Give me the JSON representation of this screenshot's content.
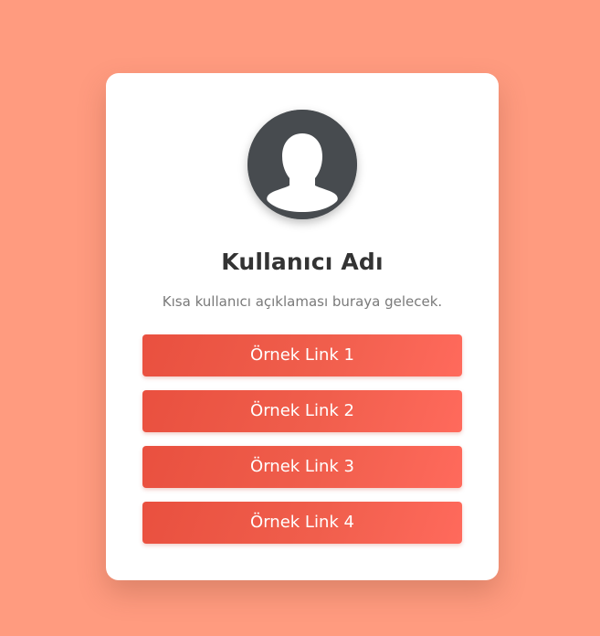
{
  "profile": {
    "name": "Kullanıcı Adı",
    "description": "Kısa kullanıcı açıklaması buraya gelecek.",
    "avatar_icon": "user-silhouette-icon"
  },
  "links": [
    {
      "label": "Örnek Link 1"
    },
    {
      "label": "Örnek Link 2"
    },
    {
      "label": "Örnek Link 3"
    },
    {
      "label": "Örnek Link 4"
    }
  ],
  "colors": {
    "background": "#ff9b7f",
    "card": "#ffffff",
    "avatar": "#474b4f",
    "button_start": "#e9503f",
    "button_end": "#ff6a5c",
    "title": "#333333",
    "description": "#7a7a7a"
  }
}
